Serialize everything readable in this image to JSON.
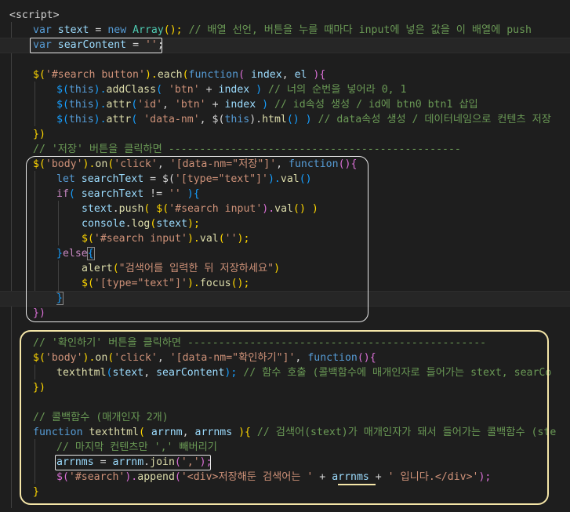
{
  "lines": {
    "l0": "<script",
    "l0b": ">",
    "l1_kw": "var",
    "l1_var": "stext",
    "l1_eq": " = ",
    "l1_new": "new",
    "l1_cls": "Array",
    "l1_rest": "();",
    "l1_cm": "// 배열 선언, 버튼을 누를 때마다 input에 넣은 값을 이 배열에 push",
    "l2_kw": "var",
    "l2_var": "searContent",
    "l2_eq": " = ",
    "l2_str": "''",
    "l2_end": ";",
    "l4_a": "$(",
    "l4_str": "'#search button'",
    "l4_b": ").",
    "l4_fn": "each",
    "l4_c": "(",
    "l4_kw": "function",
    "l4_d": "( ",
    "l4_p1": "index",
    "l4_e": ", ",
    "l4_p2": "el",
    "l4_f": " ){",
    "l5_a": "$(",
    "l5_this": "this",
    "l5_b": ").",
    "l5_fn": "addClass",
    "l5_c": "( ",
    "l5_str": "'btn'",
    "l5_d": " + ",
    "l5_var": "index",
    "l5_e": " ) ",
    "l5_cm": "// 너의 순번을 넣어라 0, 1",
    "l6_a": "$(",
    "l6_this": "this",
    "l6_b": ").",
    "l6_fn": "attr",
    "l6_c": "(",
    "l6_str1": "'id'",
    "l6_d": ", ",
    "l6_str2": "'btn'",
    "l6_e": " + ",
    "l6_var": "index",
    "l6_f": " ) ",
    "l6_cm": "// id속성 생성 / id에 btn0 btn1 삽입",
    "l7_a": "$(",
    "l7_this": "this",
    "l7_b": ").",
    "l7_fn": "attr",
    "l7_c": "( ",
    "l7_str": "'data-nm'",
    "l7_d": ", $(",
    "l7_this2": "this",
    "l7_e": ").",
    "l7_fn2": "html",
    "l7_f": "() ) ",
    "l7_cm": "// data속성 생성 / 데이터네임으로 컨텐츠 저장",
    "l8": "})",
    "l9_cm": "// '저장' 버튼을 클릭하면 -----------------------------------------------",
    "l10_a": "$(",
    "l10_str1": "'body'",
    "l10_b": ").",
    "l10_fn": "on",
    "l10_c": "(",
    "l10_str2": "'click'",
    "l10_d": ", ",
    "l10_str3": "'[data-nm=\"저장\"]'",
    "l10_e": ", ",
    "l10_kw": "function",
    "l10_f": "(){",
    "l11_kw": "let",
    "l11_var": "searchText",
    "l11_a": " = $(",
    "l11_str": "'[type=\"text\"]'",
    "l11_b": ").",
    "l11_fn": "val",
    "l11_c": "()",
    "l12_kw": "if",
    "l12_a": "( ",
    "l12_var": "searchText",
    "l12_b": " != ",
    "l12_str": "''",
    "l12_c": " ){",
    "l13_var": "stext",
    "l13_a": ".",
    "l13_fn": "push",
    "l13_b": "( $(",
    "l13_str": "'#search input'",
    "l13_c": ").",
    "l13_fn2": "val",
    "l13_d": "() )",
    "l14_var": "console",
    "l14_a": ".",
    "l14_fn": "log",
    "l14_b": "(",
    "l14_var2": "stext",
    "l14_c": ");",
    "l15_a": "$(",
    "l15_str": "'#search input'",
    "l15_b": ").",
    "l15_fn": "val",
    "l15_c": "(",
    "l15_str2": "''",
    "l15_d": ");",
    "l16_a": "}",
    "l16_kw": "else",
    "l16_b": "{",
    "l17_fn": "alert",
    "l17_a": "(",
    "l17_str": "\"검색어를 입력한 뒤 저장하세요\"",
    "l17_b": ")",
    "l18_a": "$(",
    "l18_str": "'[type=\"text\"]'",
    "l18_b": ").",
    "l18_fn": "focus",
    "l18_c": "();",
    "l19": "}",
    "l20": "})",
    "l22_cm": "// '확인하기' 버튼을 클릭하면 ------------------------------------------------",
    "l23_a": "$(",
    "l23_str1": "'body'",
    "l23_b": ").",
    "l23_fn": "on",
    "l23_c": "(",
    "l23_str2": "'click'",
    "l23_d": ", ",
    "l23_str3": "'[data-nm=\"확인하기\"]'",
    "l23_e": ", ",
    "l23_kw": "function",
    "l23_f": "(){",
    "l24_fn": "texthtml",
    "l24_a": "(",
    "l24_var1": "stext",
    "l24_b": ", ",
    "l24_var2": "searContent",
    "l24_c": "); ",
    "l24_cm": "// 함수 호출 (콜백함수에 매개인자로 들어가는 stext, searCo",
    "l25": "})",
    "l27_cm": "// 콜백함수 (매개인자 2개)",
    "l28_kw": "function",
    "l28_fn": "texthtml",
    "l28_a": "( ",
    "l28_p1": "arrnm",
    "l28_b": ", ",
    "l28_p2": "arrnms",
    "l28_c": " ){ ",
    "l28_cm": "// 검색어(stext)가 매개인자가 돼서 들어가는 콜백함수 (ste",
    "l29_cm": "// 마지막 컨텐츠만 ',' 빼버리기",
    "l30_var": "arrnms",
    "l30_a": " = ",
    "l30_var2": "arrnm",
    "l30_b": ".",
    "l30_fn": "join",
    "l30_c": "(",
    "l30_str": "','",
    "l30_d": ");",
    "l31_a": "$(",
    "l31_str1": "'#search'",
    "l31_b": ").",
    "l31_fn": "append",
    "l31_c": "(",
    "l31_str2": "'<div>저장해둔 검색어는 '",
    "l31_d": " + ",
    "l31_var": "arrnms",
    "l31_e": " + ",
    "l31_str3": "' 입니다.</div>'",
    "l31_f": ");",
    "l32": "}"
  }
}
